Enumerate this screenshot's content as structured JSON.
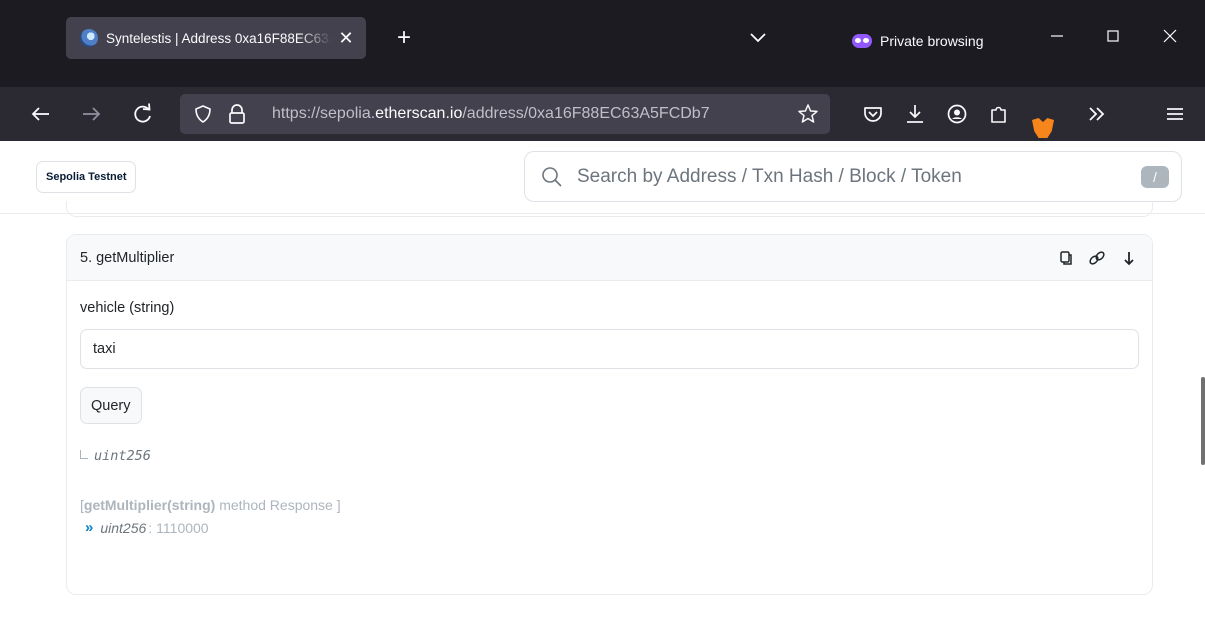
{
  "browser": {
    "tab_title": "Syntelestis | Address 0xa16F88EC63A5FCDb7",
    "tab_close": "✕",
    "new_tab": "+",
    "private_label": "Private browsing",
    "url_scheme": "https://sepolia.",
    "url_host": "etherscan.io",
    "url_path": "/address/0xa16F88EC63A5FCDb7",
    "icons": [
      "back-icon",
      "forward-icon",
      "reload-icon",
      "shield-icon",
      "lock-icon",
      "bookmark-star-icon",
      "pocket-icon",
      "download-icon",
      "account-icon",
      "extensions-icon",
      "metamask-icon",
      "overflow-icon",
      "menu-icon"
    ]
  },
  "header": {
    "network_label": "Sepolia Testnet",
    "search_placeholder": "Search by Address / Txn Hash / Block / Token",
    "search_shortcut": "/"
  },
  "function_card": {
    "title": "5. getMultiplier",
    "param_label": "vehicle (string)",
    "param_value": "taxi",
    "query_label": "Query",
    "return_type": "uint256",
    "response_prefix": "[",
    "response_method": "getMultiplier(string)",
    "response_suffix": "method Response ]",
    "response_chevron": "»",
    "response_type": "uint256",
    "response_colon": ":",
    "response_value": "1110000"
  }
}
